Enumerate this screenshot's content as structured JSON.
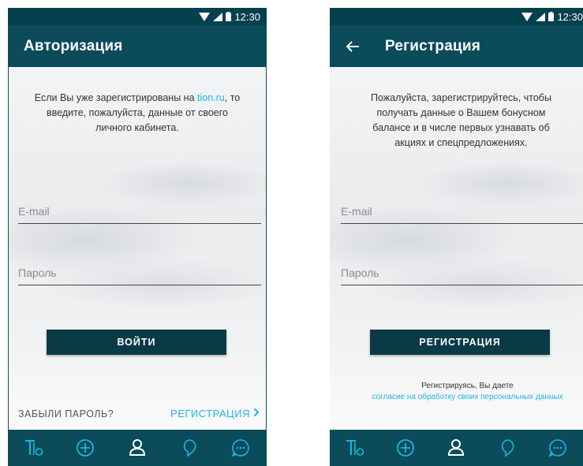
{
  "status_bar": {
    "time": "12:30"
  },
  "login_screen": {
    "title": "Авторизация",
    "intro_before_link": "Если Вы уже зарегистрированы на ",
    "intro_link": "tion.ru",
    "intro_after_link": ", то введите, пожалуйста, данные от своего личного кабинета.",
    "email_placeholder": "E-mail",
    "password_placeholder": "Пароль",
    "login_button": "ВОЙТИ",
    "forgot_password": "ЗАБЫЛИ ПАРОЛЬ?",
    "register_link": "РЕГИСТРАЦИЯ"
  },
  "register_screen": {
    "title": "Регистрация",
    "intro": "Пожалуйста, зарегистрируйтесь, чтобы получать данные о Вашем бонусном балансе и в числе первых узнавать об акциях и спецпредложениях.",
    "email_placeholder": "E-mail",
    "password_placeholder": "Пароль",
    "register_button": "РЕГИСТРАЦИЯ",
    "consent_text": "Регистрируясь, Вы даете",
    "consent_link": "согласие на обработку своих персональных данных"
  },
  "bottom_nav": {
    "icons": [
      "tion-logo-icon",
      "plus-circle-icon",
      "user-icon",
      "bulb-icon",
      "chat-icon"
    ],
    "active_index": 2,
    "active_color": "#ffffff",
    "inactive_color": "#1cb5e0"
  },
  "colors": {
    "appbar": "#0b4b5a",
    "statusbar": "#04404e",
    "button": "#0b3a47",
    "link": "#1cb5e0"
  }
}
